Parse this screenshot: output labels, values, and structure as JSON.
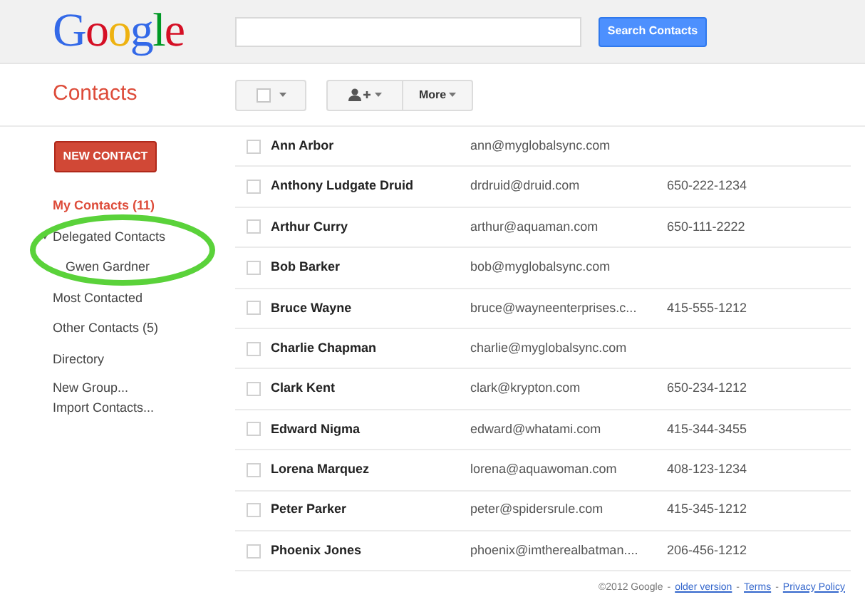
{
  "header": {
    "logo": "Google",
    "search_button": "Search Contacts"
  },
  "app_title": "Contacts",
  "toolbar": {
    "select_all_checked": false,
    "more_button": "More"
  },
  "sidebar": {
    "new_button": "NEW CONTACT",
    "items": [
      {
        "kind": "group",
        "label": "My Contacts (11)",
        "selected": true
      },
      {
        "kind": "group",
        "label": "Delegated Contacts",
        "selected": false,
        "expanded": true,
        "children": [
          {
            "label": "Gwen Gardner",
            "selected": false
          }
        ]
      },
      {
        "kind": "group",
        "label": "Most Contacted",
        "selected": false
      },
      {
        "kind": "group",
        "label": "Other Contacts (5)",
        "selected": false
      },
      {
        "kind": "group",
        "label": "Directory",
        "selected": false
      },
      {
        "kind": "action",
        "label": "New Group..."
      },
      {
        "kind": "action",
        "label": "Import Contacts..."
      }
    ]
  },
  "contacts": [
    {
      "name": "Ann Arbor",
      "email": "ann@myglobalsync.com",
      "checked": false
    },
    {
      "name": "Anthony Ludgate Druid",
      "email": "drdruid@druid.com",
      "phone": "650-222-1234",
      "checked": false
    },
    {
      "name": "Arthur Curry",
      "email": "arthur@aquaman.com",
      "phone": "650-111-2222",
      "checked": false
    },
    {
      "name": "Bob Barker",
      "email": "bob@myglobalsync.com",
      "checked": false
    },
    {
      "name": "Bruce Wayne",
      "email": "bruce@wayneenterprises.c...",
      "phone": "415-555-1212",
      "checked": false
    },
    {
      "name": "Charlie Chapman",
      "email": "charlie@myglobalsync.com",
      "checked": false
    },
    {
      "name": "Clark Kent",
      "email": "clark@krypton.com",
      "phone": "650-234-1212",
      "checked": false
    },
    {
      "name": "Edward Nigma",
      "email": "edward@whatami.com",
      "phone": "415-344-3455",
      "checked": false
    },
    {
      "name": "Lorena Marquez",
      "email": "lorena@aquawoman.com",
      "phone": "408-123-1234",
      "checked": false
    },
    {
      "name": "Peter Parker",
      "email": "peter@spidersrule.com",
      "phone": "415-345-1212",
      "checked": false
    },
    {
      "name": "Phoenix Jones",
      "email": "phoenix@imtherealbatman....",
      "phone": "206-456-1212",
      "checked": false
    }
  ],
  "footer": [
    {
      "kind": "text",
      "text": "©2012 Google"
    },
    {
      "kind": "sep",
      "text": "-"
    },
    {
      "kind": "link",
      "text": "older version"
    },
    {
      "kind": "sep",
      "text": "-"
    },
    {
      "kind": "link",
      "text": "Terms"
    },
    {
      "kind": "sep",
      "text": "-"
    },
    {
      "kind": "link",
      "text": "Privacy Policy"
    }
  ]
}
